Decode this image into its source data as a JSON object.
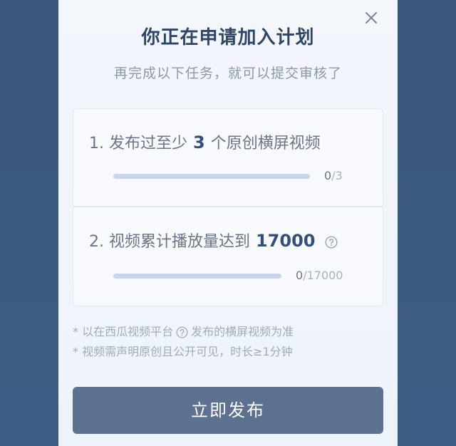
{
  "dialog": {
    "title": "你正在申请加入计划",
    "subtitle": "再完成以下任务，就可以提交审核了"
  },
  "tasks": [
    {
      "prefix": "1. 发布过至少",
      "number": "3",
      "suffix": "个原创横屏视频",
      "progress_current": "0",
      "progress_total": "/3",
      "progress_fraction": 0
    },
    {
      "prefix": "2. 视频累计播放量达到",
      "number": "17000",
      "suffix": "",
      "progress_current": "0",
      "progress_total": "/17000",
      "progress_fraction": 0
    }
  ],
  "notes": {
    "line1_before": "* 以在西瓜视频平台",
    "line1_after": "发布的横屏视频为准",
    "line2": "* 视频需声明原创且公开可见，时长≥1分钟"
  },
  "button": {
    "publish_label": "立即发布"
  },
  "colors": {
    "accent": "#34507a",
    "button": "#5c7290",
    "bar_track": "#c9d6ea"
  }
}
